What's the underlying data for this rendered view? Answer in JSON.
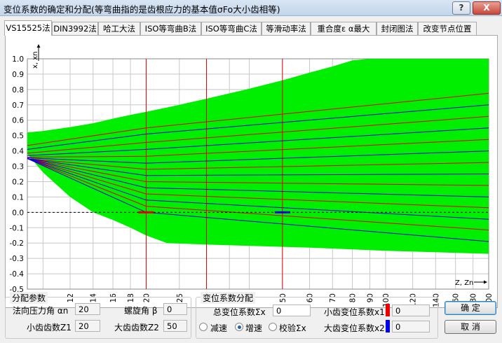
{
  "window": {
    "title": "变位系数的确定和分配(等弯曲指的是齿根应力的基本值σFo大小齿相等)",
    "help_label": "?",
    "close_label": "X"
  },
  "tabs": [
    "VS15525法",
    "DIN3992法",
    "哈工大法",
    "ISO等弯曲B法",
    "ISO等弯曲C法",
    "等滑动率法",
    "重合度ε α最大",
    "封闭图法",
    "改变节点位置"
  ],
  "active_tab": 0,
  "chart_data": {
    "type": "area",
    "ylabel": "x, xn",
    "xlabel": "Z, Zn",
    "ylim": [
      -0.5,
      1.0
    ],
    "y_ticks": [
      "1.0",
      "0.9",
      "0.8",
      "0.7",
      "0.6",
      "0.5",
      "0.4",
      "0.3",
      "0.2",
      "0.1",
      "0.0",
      "-0.1",
      "-0.2",
      "-0.3",
      "-0.4",
      "-0.5"
    ],
    "x_scale": "log",
    "xlim": [
      9,
      200
    ],
    "x_ticks": [
      "9",
      "10",
      "12",
      "14",
      "16",
      "18",
      "20",
      "25",
      "30",
      "35",
      "40",
      "50",
      "60",
      "70",
      "80",
      "90",
      "100",
      "120",
      "140",
      "160",
      "180",
      "200"
    ],
    "grid": true,
    "region": {
      "color": "#00ee00",
      "upper": [
        [
          9,
          0.52
        ],
        [
          10,
          0.53
        ],
        [
          12,
          0.555
        ],
        [
          14,
          0.58
        ],
        [
          16,
          0.61
        ],
        [
          18,
          0.635
        ],
        [
          20,
          0.655
        ],
        [
          25,
          0.7
        ],
        [
          30,
          0.74
        ],
        [
          40,
          0.805
        ],
        [
          50,
          0.86
        ],
        [
          60,
          0.91
        ],
        [
          70,
          0.95
        ],
        [
          80,
          0.99
        ],
        [
          90,
          1.0
        ],
        [
          200,
          1.0
        ]
      ],
      "lower": [
        [
          200,
          -0.27
        ],
        [
          100,
          -0.25
        ],
        [
          60,
          -0.23
        ],
        [
          30,
          -0.21
        ],
        [
          23,
          -0.2
        ],
        [
          20,
          -0.15
        ],
        [
          18,
          -0.1
        ],
        [
          16,
          -0.05
        ],
        [
          14,
          0.0
        ],
        [
          12,
          0.1
        ],
        [
          10,
          0.26
        ],
        [
          9,
          0.38
        ]
      ]
    },
    "red_lines": [
      [
        [
          9,
          0.435
        ],
        [
          20,
          0.55
        ],
        [
          200,
          0.775
        ]
      ],
      [
        [
          9,
          0.385
        ],
        [
          20,
          0.455
        ],
        [
          200,
          0.625
        ]
      ],
      [
        [
          9,
          0.36
        ],
        [
          20,
          0.365
        ],
        [
          200,
          0.475
        ]
      ],
      [
        [
          9,
          0.35
        ],
        [
          20,
          0.28
        ],
        [
          200,
          0.325
        ]
      ],
      [
        [
          9,
          0.35
        ],
        [
          20,
          0.2
        ],
        [
          200,
          0.175
        ]
      ],
      [
        [
          9,
          0.35
        ],
        [
          20,
          0.12
        ],
        [
          200,
          0.03
        ]
      ],
      [
        [
          9,
          0.35
        ],
        [
          20,
          0.04
        ],
        [
          200,
          -0.115
        ]
      ]
    ],
    "blue_lines": [
      [
        [
          9,
          0.41
        ],
        [
          20,
          0.51
        ],
        [
          200,
          0.7
        ]
      ],
      [
        [
          9,
          0.37
        ],
        [
          20,
          0.41
        ],
        [
          200,
          0.55
        ]
      ],
      [
        [
          9,
          0.355
        ],
        [
          20,
          0.32
        ],
        [
          200,
          0.4
        ]
      ],
      [
        [
          9,
          0.35
        ],
        [
          20,
          0.24
        ],
        [
          200,
          0.25
        ]
      ],
      [
        [
          9,
          0.35
        ],
        [
          20,
          0.16
        ],
        [
          200,
          0.1
        ]
      ],
      [
        [
          9,
          0.35
        ],
        [
          20,
          0.08
        ],
        [
          200,
          -0.045
        ]
      ],
      [
        [
          9,
          0.35
        ],
        [
          20,
          0.0
        ],
        [
          200,
          -0.19
        ]
      ]
    ],
    "zero_line": true,
    "vertical_markers": [
      20,
      30,
      50
    ],
    "points": [
      {
        "z": 20,
        "x": 0,
        "color": "#e00000"
      },
      {
        "z": 50,
        "x": 0,
        "color": "#0000e0"
      }
    ]
  },
  "assign_params": {
    "title": "分配参数",
    "pressure_angle_label": "法向压力角 αn",
    "pressure_angle": "20",
    "helix_angle_label": "螺旋角 β",
    "helix_angle": "0",
    "z1_label": "小齿齿数Z1",
    "z1": "20",
    "z2_label": "大齿齿数Z2",
    "z2": "50"
  },
  "distribution": {
    "title": "变位系数分配",
    "total_label": "总变位系数Σx",
    "total": "0",
    "x1_label": "小齿变位系数x1",
    "x1": "0",
    "x1_color": "#ee0000",
    "x2_label": "大齿变位系数x2",
    "x2": "0",
    "x2_color": "#0000ee",
    "modes": [
      "减速",
      "增速",
      "校验Σx"
    ],
    "selected_mode": 1
  },
  "buttons": {
    "ok": "确 定",
    "cancel": "取 消"
  }
}
